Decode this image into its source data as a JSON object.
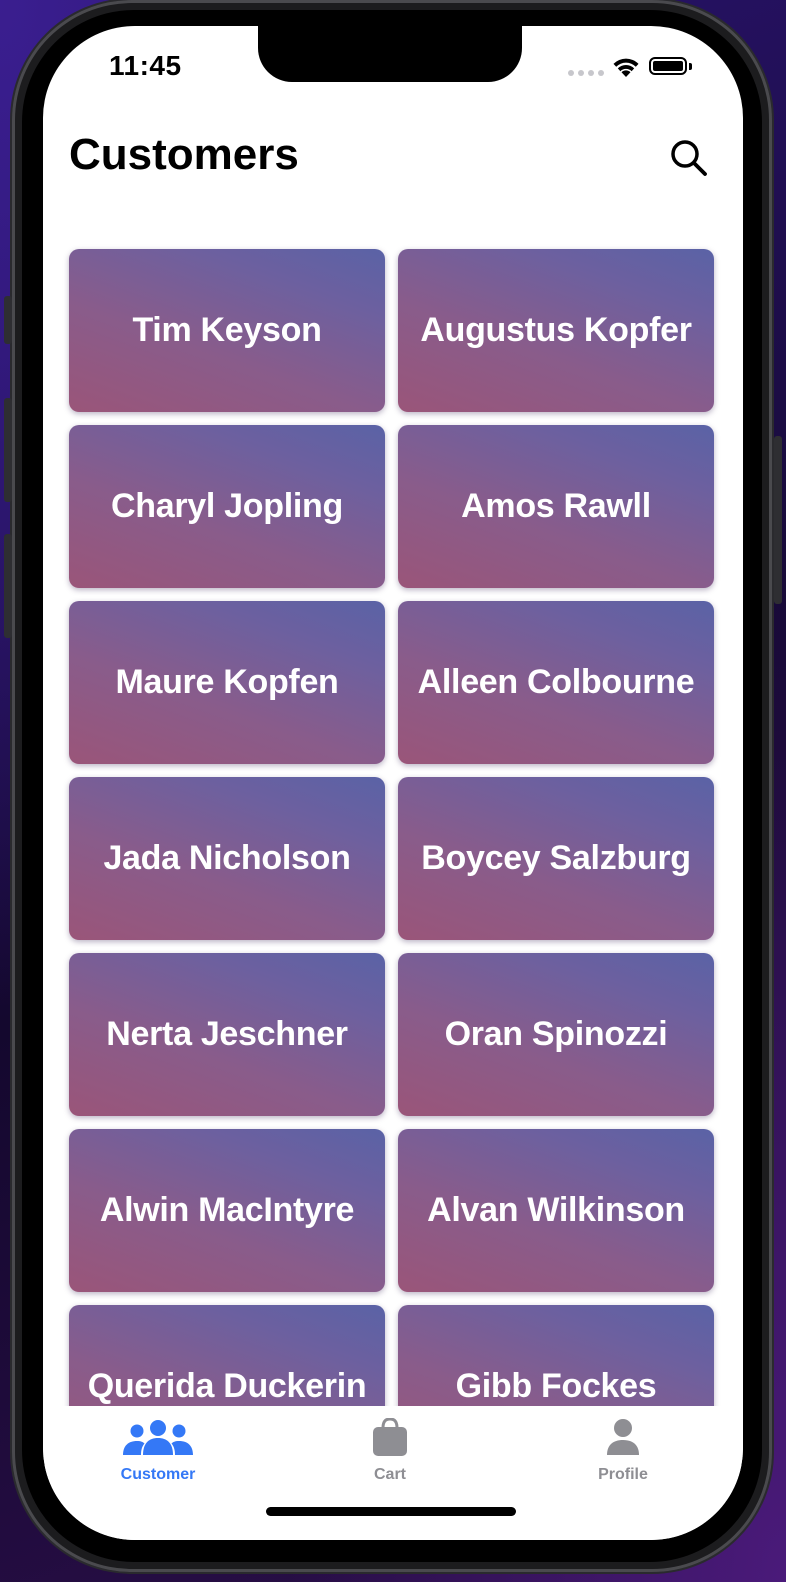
{
  "status_bar": {
    "time": "11:45"
  },
  "header": {
    "title": "Customers",
    "search_icon": "search-icon"
  },
  "customers": [
    "Tim Keyson",
    "Augustus Kopfer",
    "Charyl Jopling",
    "Amos Rawll",
    "Maure Kopfen",
    "Alleen Colbourne",
    "Jada Nicholson",
    "Boycey Salzburg",
    "Nerta Jeschner",
    "Oran Spinozzi",
    "Alwin MacIntyre",
    "Alvan Wilkinson",
    "Querida Duckerin",
    "Gibb Fockes"
  ],
  "tab_bar": {
    "tabs": [
      {
        "label": "Customer",
        "icon": "people-icon",
        "active": true
      },
      {
        "label": "Cart",
        "icon": "bag-icon",
        "active": false
      },
      {
        "label": "Profile",
        "icon": "person-icon",
        "active": false
      }
    ],
    "active_color": "#3478f6",
    "inactive_color": "#8e8e93"
  },
  "colors": {
    "card_gradient_start": "#9a5579",
    "card_gradient_end": "#5a62a6"
  }
}
